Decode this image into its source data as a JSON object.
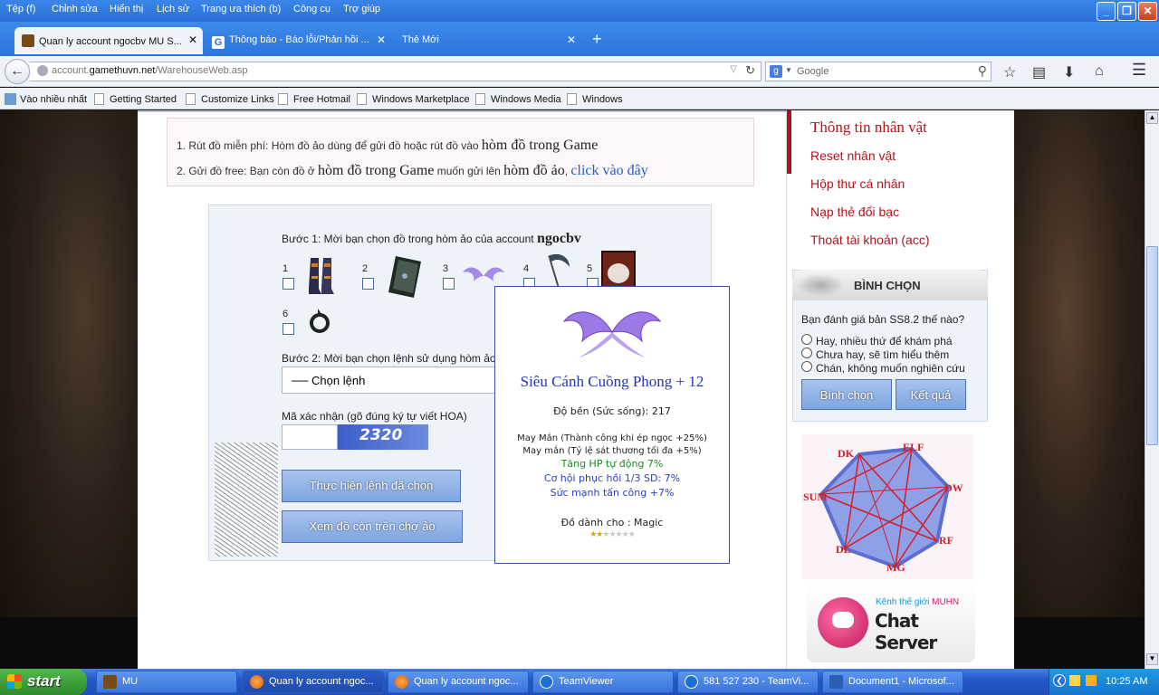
{
  "menu": [
    "Tệp (f)",
    "Chỉnh sửa",
    "Hiển thị",
    "Lịch sử",
    "Trang ưa thích (b)",
    "Công cụ",
    "Trợ giúp"
  ],
  "tabs": [
    {
      "label": "Quan ly account ngocbv MU S..."
    },
    {
      "label": "Thông báo - Báo lỗi/Phản hồi ..."
    },
    {
      "label": "Thẻ Mới"
    }
  ],
  "nav": {
    "url_prefix": "account.",
    "url_domain": "gamethuvn.net",
    "url_path": "/WarehouseWeb.asp",
    "search_placeholder": "Google"
  },
  "bookmarks": [
    "Vào nhiều nhất",
    "Getting Started",
    "Customize Links",
    "Free Hotmail",
    "Windows Marketplace",
    "Windows Media",
    "Windows"
  ],
  "notice": {
    "line1_text": "1. Rút đồ miễn phí: Hòm đồ ảo dùng để gửi đồ hoặc rút đồ vào ",
    "line1_big": "hòm đồ trong Game",
    "line2_text": "2. Gửi đồ free: Bạn còn đồ ở ",
    "line2_big1": "hòm đồ trong Game",
    "line2_mid": " muốn gửi lên ",
    "line2_big2": "hòm đồ ảo",
    "line2_comma": ", ",
    "line2_link": "click vào đây"
  },
  "form": {
    "step1": "Bước 1: Mời bạn chọn đồ trong hòm ảo của account ",
    "account": "ngocbv",
    "items": [
      "1",
      "2",
      "3",
      "4",
      "5",
      "6"
    ],
    "step2": "Bước 2: Mời bạn chọn lệnh sử dụng hòm ảo",
    "select_value": "── Chọn lệnh",
    "captcha_label": "Mã xác nhận (gõ đúng ký tự viết HOA)",
    "captcha_value": "",
    "captcha_code": "2320",
    "btn_execute": "Thực hiện lệnh đã chọn",
    "btn_view": "Xem đồ còn trên chợ ảo"
  },
  "tooltip": {
    "name": "Siêu Cánh Cuồng Phong + 12",
    "durability": "Độ bền (Sức sống): 217",
    "luck1": "May Mắn (Thành công khi ép ngọc +25%)",
    "luck2": "May mắn (Tỷ lệ sát thương tối đa +5%)",
    "opt1": "Tăng HP tự động 7%",
    "opt2": "Cơ hội phục hồi 1/3 SD: 7%",
    "opt3": "Sức mạnh tấn công +7%",
    "for_class": "Đồ dành cho : Magic",
    "stars": 2,
    "stars_max": 7
  },
  "sidebar": {
    "menu": [
      "Thông tin nhân vật",
      "Reset nhân vật",
      "Hộp thư cá nhân",
      "Nạp thẻ đổi bạc",
      "Thoát tài khoản (acc)"
    ],
    "vote_title": "BÌNH CHỌN",
    "vote_question": "Bạn đánh giá bản SS8.2 thế nào?",
    "vote_options": [
      "Hay, nhiều thứ để khám phá",
      "Chưa hay, sẽ tìm hiểu thêm",
      "Chán, không muốn nghiên cứu"
    ],
    "vote_btn": "Bình chọn",
    "result_btn": "Kết quả",
    "classes": [
      "DK",
      "ELF",
      "DW",
      "RF",
      "MG",
      "DL",
      "SUM"
    ],
    "chat_sub": "Kênh thế giới",
    "chat_sub_brand": "MUHN",
    "chat_title": "Chat Server"
  },
  "taskbar": {
    "start": "start",
    "items": [
      "MU",
      "Quan ly account ngoc...",
      "Quan ly account ngoc...",
      "TeamViewer",
      "581 527 230 - TeamVi...",
      "Document1 - Microsof..."
    ],
    "clock": "10:25 AM"
  },
  "colors": {
    "accent": "#b4121c",
    "link": "#1f5fbf",
    "tooltip_name": "#2435b5",
    "xp_blue": "#2a6fd6"
  }
}
